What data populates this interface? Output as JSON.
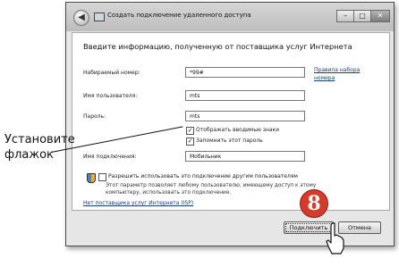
{
  "window": {
    "title": "Создать подключение удаленного доступа",
    "controls": {
      "minimize": "–",
      "maximize": "□",
      "close": "✕"
    },
    "back_glyph": "◀"
  },
  "form": {
    "heading": "Введите информацию, полученную от поставщика услуг Интернета",
    "phone_label": "Набираемый номер:",
    "phone_value": "*99#",
    "rules_link": "Правила набора номера",
    "user_label": "Имя пользователя:",
    "user_value": "mts",
    "password_label": "Пароль:",
    "password_value": "mts",
    "show_chars_label": "Отображать вводимые знаки",
    "show_chars_checked": true,
    "remember_label": "Запомнить этот пароль",
    "remember_checked": true,
    "connection_label": "Имя подключения:",
    "connection_value": "Мобильник",
    "allow_others_label": "Разрешить использовать это подключение другим пользователям",
    "allow_others_checked": false,
    "allow_note_line1": "Этот параметр позволяет любому пользователю, имеющему доступ к этому",
    "allow_note_line2": "компьютеру, использовать это подключение.",
    "no_isp_link": "Нет поставщика услуг Интернета (ISP)"
  },
  "buttons": {
    "connect": "Подключить",
    "cancel": "Отмена"
  },
  "annotation": {
    "callout_line1": "Установите",
    "callout_line2": "флажок",
    "step_number": "8"
  },
  "icons": [
    "back-arrow-icon",
    "network-icon",
    "shield-icon",
    "hand-cursor-icon"
  ]
}
